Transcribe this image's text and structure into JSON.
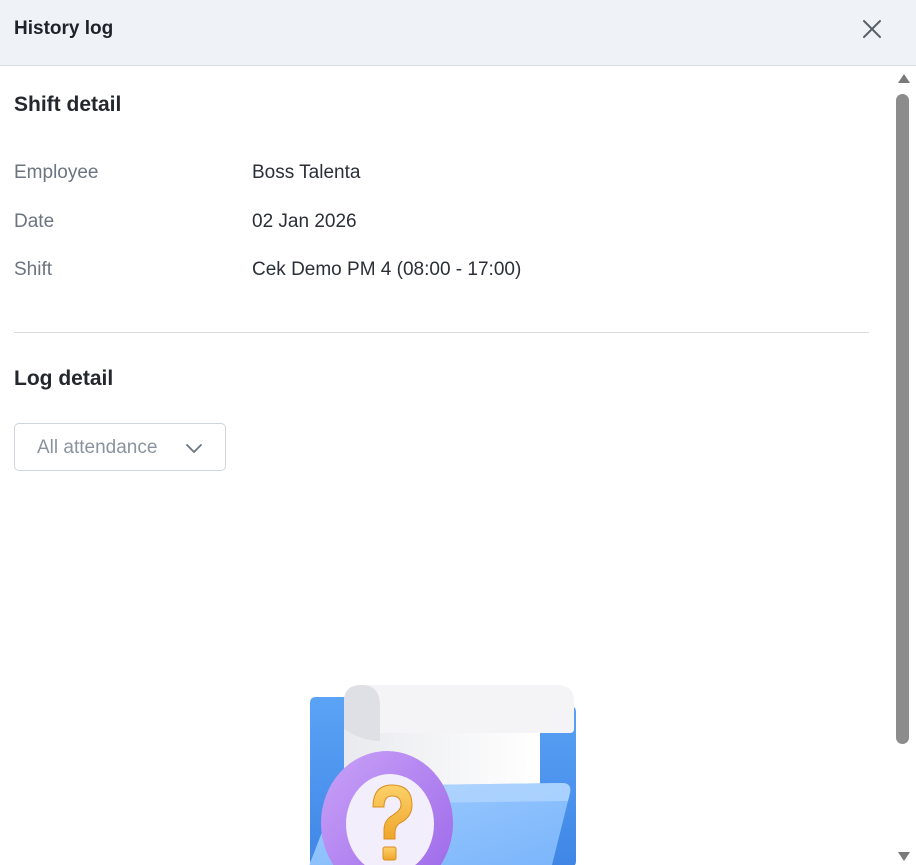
{
  "header": {
    "title": "History log",
    "close_icon": "close-icon"
  },
  "shift_detail": {
    "title": "Shift detail",
    "rows": [
      {
        "label": "Employee",
        "value": "Boss Talenta"
      },
      {
        "label": "Date",
        "value": "02 Jan 2026"
      },
      {
        "label": "Shift",
        "value": "Cek Demo PM 4 (08:00 - 17:00)"
      }
    ]
  },
  "log_detail": {
    "title": "Log detail",
    "filter": {
      "selected": "All attendance",
      "icon": "chevron-down-icon"
    },
    "empty_state_icon": "folder-question-illustration"
  },
  "colors": {
    "header_bg": "#eff3f8",
    "folder_blue": "#8cc0ff",
    "badge_purple": "#b58bf2",
    "question_yellow": "#f5b73b"
  }
}
